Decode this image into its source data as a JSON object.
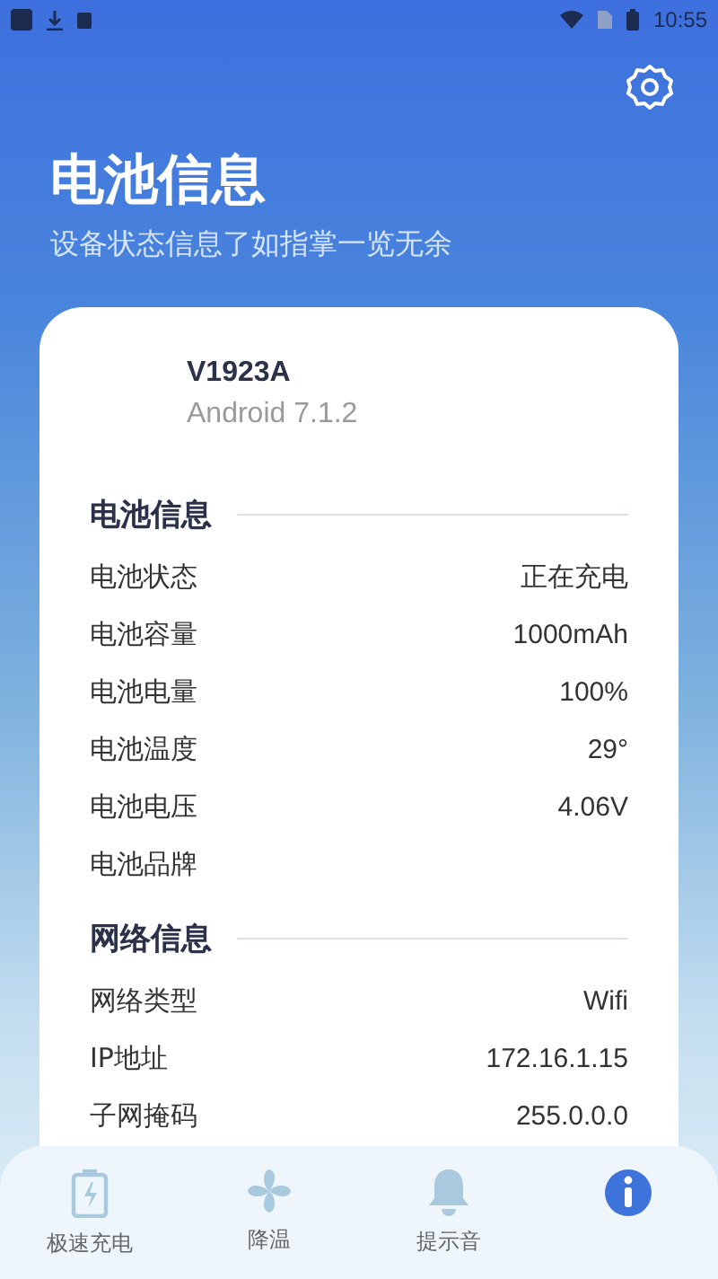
{
  "status_bar": {
    "time": "10:55"
  },
  "header": {
    "title": "电池信息",
    "subtitle": "设备状态信息了如指掌一览无余"
  },
  "device": {
    "model": "V1923A",
    "os": "Android 7.1.2"
  },
  "sections": [
    {
      "title": "电池信息",
      "rows": [
        {
          "label": "电池状态",
          "value": "正在充电"
        },
        {
          "label": "电池容量",
          "value": "1000mAh"
        },
        {
          "label": "电池电量",
          "value": "100%"
        },
        {
          "label": "电池温度",
          "value": "29°"
        },
        {
          "label": "电池电压",
          "value": "4.06V"
        },
        {
          "label": "电池品牌"
        }
      ]
    },
    {
      "title": "网络信息",
      "rows": [
        {
          "label": "网络类型",
          "value": "Wifi"
        },
        {
          "label": "IP地址",
          "value": "172.16.1.15"
        },
        {
          "label": "子网掩码",
          "value": "255.0.0.0"
        }
      ]
    }
  ],
  "tabs": [
    {
      "kind": "battery",
      "label": "极速充电",
      "selected": false
    },
    {
      "kind": "fan",
      "label": "降温",
      "selected": false
    },
    {
      "kind": "bell",
      "label": "提示音",
      "selected": false
    },
    {
      "kind": "info",
      "selected": true
    }
  ]
}
